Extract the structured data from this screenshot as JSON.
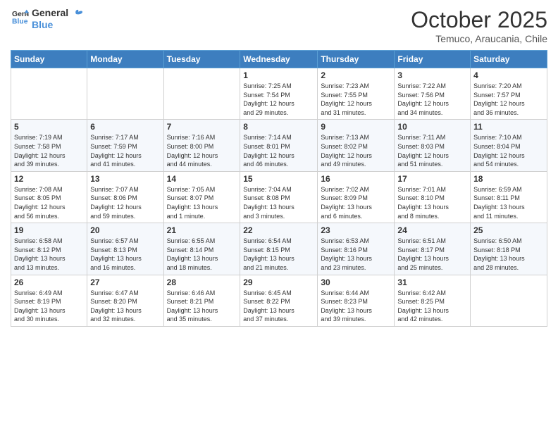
{
  "logo": {
    "line1": "General",
    "line2": "Blue"
  },
  "header": {
    "month": "October 2025",
    "location": "Temuco, Araucania, Chile"
  },
  "weekdays": [
    "Sunday",
    "Monday",
    "Tuesday",
    "Wednesday",
    "Thursday",
    "Friday",
    "Saturday"
  ],
  "weeks": [
    [
      {
        "day": "",
        "info": ""
      },
      {
        "day": "",
        "info": ""
      },
      {
        "day": "",
        "info": ""
      },
      {
        "day": "1",
        "info": "Sunrise: 7:25 AM\nSunset: 7:54 PM\nDaylight: 12 hours\nand 29 minutes."
      },
      {
        "day": "2",
        "info": "Sunrise: 7:23 AM\nSunset: 7:55 PM\nDaylight: 12 hours\nand 31 minutes."
      },
      {
        "day": "3",
        "info": "Sunrise: 7:22 AM\nSunset: 7:56 PM\nDaylight: 12 hours\nand 34 minutes."
      },
      {
        "day": "4",
        "info": "Sunrise: 7:20 AM\nSunset: 7:57 PM\nDaylight: 12 hours\nand 36 minutes."
      }
    ],
    [
      {
        "day": "5",
        "info": "Sunrise: 7:19 AM\nSunset: 7:58 PM\nDaylight: 12 hours\nand 39 minutes."
      },
      {
        "day": "6",
        "info": "Sunrise: 7:17 AM\nSunset: 7:59 PM\nDaylight: 12 hours\nand 41 minutes."
      },
      {
        "day": "7",
        "info": "Sunrise: 7:16 AM\nSunset: 8:00 PM\nDaylight: 12 hours\nand 44 minutes."
      },
      {
        "day": "8",
        "info": "Sunrise: 7:14 AM\nSunset: 8:01 PM\nDaylight: 12 hours\nand 46 minutes."
      },
      {
        "day": "9",
        "info": "Sunrise: 7:13 AM\nSunset: 8:02 PM\nDaylight: 12 hours\nand 49 minutes."
      },
      {
        "day": "10",
        "info": "Sunrise: 7:11 AM\nSunset: 8:03 PM\nDaylight: 12 hours\nand 51 minutes."
      },
      {
        "day": "11",
        "info": "Sunrise: 7:10 AM\nSunset: 8:04 PM\nDaylight: 12 hours\nand 54 minutes."
      }
    ],
    [
      {
        "day": "12",
        "info": "Sunrise: 7:08 AM\nSunset: 8:05 PM\nDaylight: 12 hours\nand 56 minutes."
      },
      {
        "day": "13",
        "info": "Sunrise: 7:07 AM\nSunset: 8:06 PM\nDaylight: 12 hours\nand 59 minutes."
      },
      {
        "day": "14",
        "info": "Sunrise: 7:05 AM\nSunset: 8:07 PM\nDaylight: 13 hours\nand 1 minute."
      },
      {
        "day": "15",
        "info": "Sunrise: 7:04 AM\nSunset: 8:08 PM\nDaylight: 13 hours\nand 3 minutes."
      },
      {
        "day": "16",
        "info": "Sunrise: 7:02 AM\nSunset: 8:09 PM\nDaylight: 13 hours\nand 6 minutes."
      },
      {
        "day": "17",
        "info": "Sunrise: 7:01 AM\nSunset: 8:10 PM\nDaylight: 13 hours\nand 8 minutes."
      },
      {
        "day": "18",
        "info": "Sunrise: 6:59 AM\nSunset: 8:11 PM\nDaylight: 13 hours\nand 11 minutes."
      }
    ],
    [
      {
        "day": "19",
        "info": "Sunrise: 6:58 AM\nSunset: 8:12 PM\nDaylight: 13 hours\nand 13 minutes."
      },
      {
        "day": "20",
        "info": "Sunrise: 6:57 AM\nSunset: 8:13 PM\nDaylight: 13 hours\nand 16 minutes."
      },
      {
        "day": "21",
        "info": "Sunrise: 6:55 AM\nSunset: 8:14 PM\nDaylight: 13 hours\nand 18 minutes."
      },
      {
        "day": "22",
        "info": "Sunrise: 6:54 AM\nSunset: 8:15 PM\nDaylight: 13 hours\nand 21 minutes."
      },
      {
        "day": "23",
        "info": "Sunrise: 6:53 AM\nSunset: 8:16 PM\nDaylight: 13 hours\nand 23 minutes."
      },
      {
        "day": "24",
        "info": "Sunrise: 6:51 AM\nSunset: 8:17 PM\nDaylight: 13 hours\nand 25 minutes."
      },
      {
        "day": "25",
        "info": "Sunrise: 6:50 AM\nSunset: 8:18 PM\nDaylight: 13 hours\nand 28 minutes."
      }
    ],
    [
      {
        "day": "26",
        "info": "Sunrise: 6:49 AM\nSunset: 8:19 PM\nDaylight: 13 hours\nand 30 minutes."
      },
      {
        "day": "27",
        "info": "Sunrise: 6:47 AM\nSunset: 8:20 PM\nDaylight: 13 hours\nand 32 minutes."
      },
      {
        "day": "28",
        "info": "Sunrise: 6:46 AM\nSunset: 8:21 PM\nDaylight: 13 hours\nand 35 minutes."
      },
      {
        "day": "29",
        "info": "Sunrise: 6:45 AM\nSunset: 8:22 PM\nDaylight: 13 hours\nand 37 minutes."
      },
      {
        "day": "30",
        "info": "Sunrise: 6:44 AM\nSunset: 8:23 PM\nDaylight: 13 hours\nand 39 minutes."
      },
      {
        "day": "31",
        "info": "Sunrise: 6:42 AM\nSunset: 8:25 PM\nDaylight: 13 hours\nand 42 minutes."
      },
      {
        "day": "",
        "info": ""
      }
    ]
  ]
}
